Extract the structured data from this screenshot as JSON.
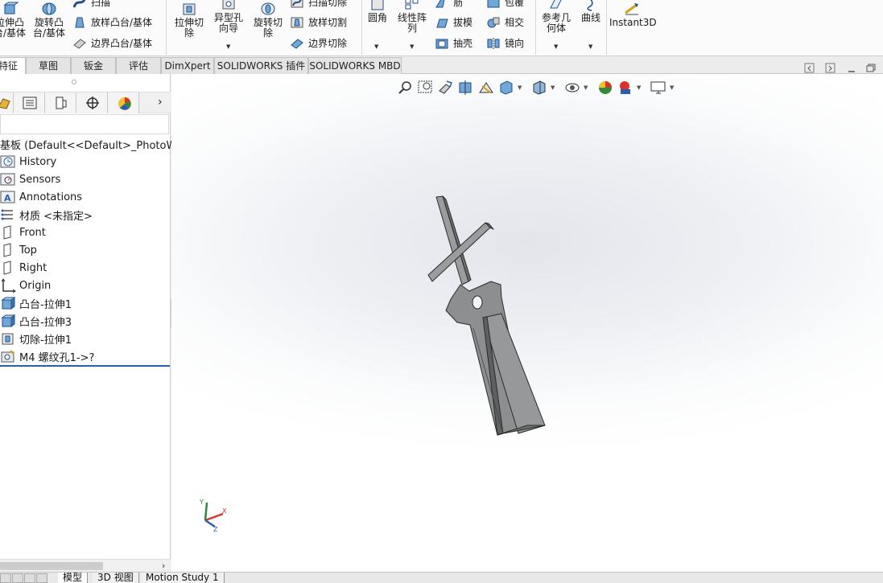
{
  "ribbon": {
    "extrude_boss": "拉伸凸\n台/基体",
    "revolve_boss": "旋转凸\n台/基体",
    "sweep": "扫描",
    "loft_boss": "放样凸台/基体",
    "boundary_boss": "边界凸台/基体",
    "extrude_cut": "拉伸切\n除",
    "hole_wizard": "异型孔\n向导",
    "revolve_cut": "旋转切\n除",
    "sweep_cut": "扫描切除",
    "loft_cut": "放样切割",
    "boundary_cut": "边界切除",
    "fillet": "圆角",
    "linear_pattern": "线性阵\n列",
    "rib": "筋",
    "draft": "拔模",
    "shell": "抽壳",
    "wrap": "包覆",
    "intersect": "相交",
    "mirror": "镜向",
    "ref_geometry": "参考几\n何体",
    "curves": "曲线",
    "instant3d": "Instant3D"
  },
  "command_tabs": [
    "特征",
    "草图",
    "钣金",
    "评估",
    "DimXpert",
    "SOLIDWORKS 插件",
    "SOLIDWORKS MBD"
  ],
  "feature_tree": {
    "root": "基板  (Default<<Default>_PhotoWor",
    "items": [
      {
        "label": "History",
        "icon": "history-icon"
      },
      {
        "label": "Sensors",
        "icon": "sensors-icon"
      },
      {
        "label": "Annotations",
        "icon": "annotations-icon"
      },
      {
        "label": "材质 <未指定>",
        "icon": "material-icon"
      },
      {
        "label": "Front",
        "icon": "plane-icon"
      },
      {
        "label": "Top",
        "icon": "plane-icon"
      },
      {
        "label": "Right",
        "icon": "plane-icon"
      },
      {
        "label": "Origin",
        "icon": "origin-icon"
      },
      {
        "label": "凸台-拉伸1",
        "icon": "boss-extrude-icon"
      },
      {
        "label": "凸台-拉伸3",
        "icon": "boss-extrude-icon"
      },
      {
        "label": "切除-拉伸1",
        "icon": "cut-extrude-icon"
      },
      {
        "label": "M4 螺纹孔1->?",
        "icon": "hole-icon"
      }
    ]
  },
  "bottom_tabs": [
    "模型",
    "3D 视图",
    "Motion Study 1"
  ],
  "triad": {
    "x": "X",
    "y": "Y",
    "z": "Z"
  },
  "colors": {
    "accent": "#2a5db0",
    "part": "#8e9092",
    "part_edge": "#2a2a2a"
  }
}
